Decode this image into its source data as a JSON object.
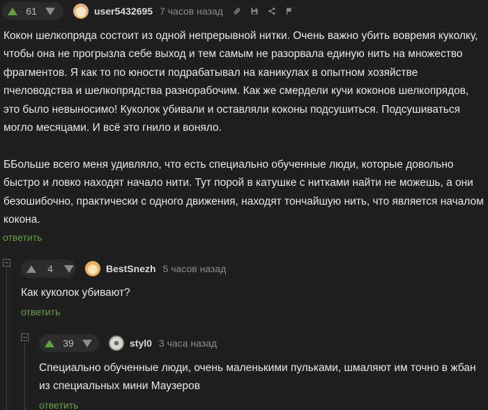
{
  "comments": [
    {
      "votes": "61",
      "username": "user5432695",
      "time": "7 часов назад",
      "text": [
        "Кокон шелкопряда состоит из одной непрерывной нитки. Очень важно убить вовремя куколку,",
        "чтобы она не прогрызла себе выход и тем самым не разорвала единую нить на множество",
        "фрагментов. Я как то по юности подрабатывал на каникулах в опытном хозяйстве",
        "пчеловодства и шелкопрядства разнорабочим. Как же смердели кучи коконов шелкопрядов,",
        "это было невыносимо! Куколок убивали и оставляли коконы подсушиться. Подсушиваться",
        "могло месяцами. И всё это гнило и воняло.",
        "",
        "ББольше всего меня удивляло, что есть специально обученные люди, которые довольно",
        "быстро и ловко находят начало нити. Тут порой в катушке с нитками найти не можешь, а они",
        "безошибочно, практически с одного движения, находят тончайшую нить, что является началом",
        "кокона."
      ],
      "reply": "ответить",
      "tools": [
        "link-icon",
        "save-icon",
        "share-icon",
        "flag-icon"
      ]
    },
    {
      "votes": "4",
      "username": "BestSnezh",
      "time": "5 часов назад",
      "text": [
        "Как куколок убивают?"
      ],
      "reply": "ответить"
    },
    {
      "votes": "39",
      "username": "styl0",
      "time": "3 часа назад",
      "text": [
        "Специально обученные люди, очень маленькими пульками, шмаляют им точно в жбан",
        "из специальных мини Маузеров"
      ],
      "reply": "ответить"
    }
  ],
  "colors": {
    "background": "#1f1f1f",
    "upvote": "#5ea33a",
    "reply_link": "#64a33e",
    "text": "#e8e8e8",
    "meta": "#8c8c8c"
  }
}
